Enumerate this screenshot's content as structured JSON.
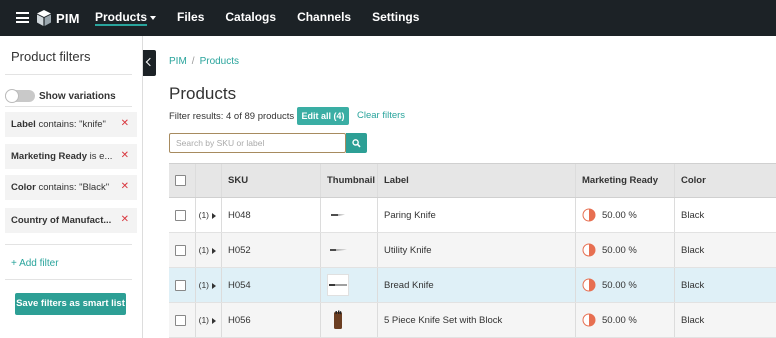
{
  "app": {
    "name": "PIM",
    "accent": "#29a49c"
  },
  "nav": [
    {
      "label": "Products",
      "active": true,
      "has_caret": true
    },
    {
      "label": "Files"
    },
    {
      "label": "Catalogs"
    },
    {
      "label": "Channels"
    },
    {
      "label": "Settings"
    }
  ],
  "sidebar": {
    "title": "Product filters",
    "toggle_label": "Show variations",
    "toggle_on": false,
    "filters": [
      {
        "name": "Label",
        "text": " contains: \"knife\""
      },
      {
        "name": "Marketing Ready",
        "text": " is e..."
      },
      {
        "name": "Color",
        "text": " contains: \"Black\""
      },
      {
        "name": "Country of Manufact...",
        "text": ""
      }
    ],
    "add_filter": "+ Add filter",
    "save_button": "Save filters as smart list"
  },
  "breadcrumb": {
    "root": "PIM",
    "sep": "/",
    "current": "Products"
  },
  "main": {
    "title": "Products",
    "filter_results": "Filter results: 4 of 89 products",
    "edit_all": "Edit all (4)",
    "clear_filters": "Clear filters",
    "search_placeholder": "Search by SKU or label"
  },
  "table": {
    "columns": [
      "SKU",
      "Thumbnail",
      "Label",
      "Marketing Ready",
      "Color"
    ],
    "rows": [
      {
        "variants": "(1)",
        "sku": "H048",
        "thumb": "paring-knife-icon",
        "label": "Paring Knife",
        "marketing_ready": "50.00 %",
        "marketing_ready_fraction": 0.5,
        "color": "Black"
      },
      {
        "variants": "(1)",
        "sku": "H052",
        "thumb": "utility-knife-icon",
        "label": "Utility Knife",
        "marketing_ready": "50.00 %",
        "marketing_ready_fraction": 0.5,
        "color": "Black"
      },
      {
        "variants": "(1)",
        "sku": "H054",
        "thumb": "bread-knife-icon",
        "label": "Bread Knife",
        "marketing_ready": "50.00 %",
        "marketing_ready_fraction": 0.5,
        "color": "Black"
      },
      {
        "variants": "(1)",
        "sku": "H056",
        "thumb": "knife-block-icon",
        "label": "5 Piece Knife Set with Block",
        "marketing_ready": "50.00 %",
        "marketing_ready_fraction": 0.5,
        "color": "Black"
      }
    ]
  },
  "colors": {
    "progress": "#e76f51",
    "remove": "#d9363e",
    "button": "#2d9f95",
    "topbar": "#1c2226"
  }
}
